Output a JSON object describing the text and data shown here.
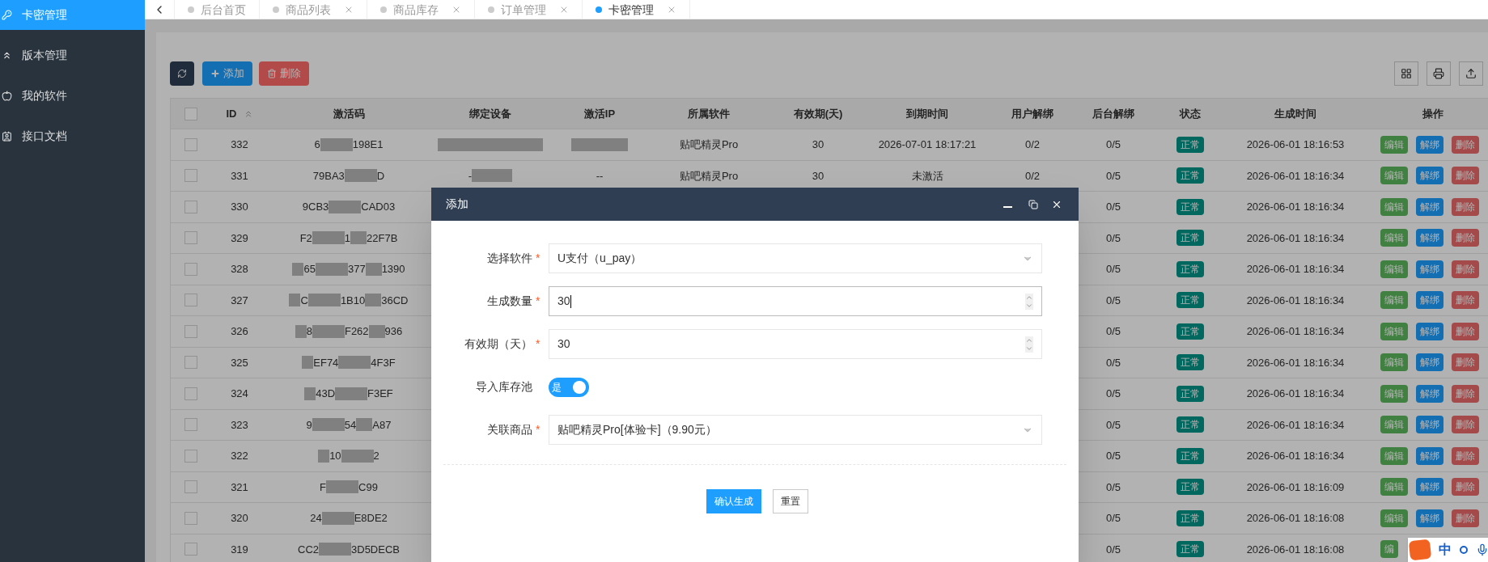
{
  "sidebar": {
    "items": [
      {
        "label": "卡密管理",
        "selected": true
      },
      {
        "label": "版本管理",
        "selected": false
      },
      {
        "label": "我的软件",
        "selected": false
      },
      {
        "label": "接口文档",
        "selected": false
      }
    ]
  },
  "tabs": [
    {
      "label": "后台首页",
      "closable": false,
      "selected": false
    },
    {
      "label": "商品列表",
      "closable": true,
      "selected": false
    },
    {
      "label": "商品库存",
      "closable": true,
      "selected": false
    },
    {
      "label": "订单管理",
      "closable": true,
      "selected": false
    },
    {
      "label": "卡密管理",
      "closable": true,
      "selected": true
    }
  ],
  "toolbar": {
    "add": "添加",
    "delete": "删除"
  },
  "table": {
    "columns": [
      "ID",
      "激活码",
      "绑定设备",
      "激活IP",
      "所属软件",
      "有效期(天)",
      "到期时间",
      "用户解绑",
      "后台解绑",
      "状态",
      "生成时间",
      "操作"
    ],
    "select_all": {
      "checked": false
    },
    "rows": [
      {
        "checked": false,
        "id": "332",
        "lead_blur": false,
        "code": [
          "6",
          "198E1"
        ],
        "device_blur": true,
        "ip_blur": true,
        "software": "贴吧精灵Pro",
        "period": "30",
        "expire": "2026-07-01 18:17:21",
        "user_unbind": "0/2",
        "admin_unbind": "0/5",
        "status": "正常",
        "created": "2026-06-01 18:16:53",
        "actions": [
          "编辑",
          "解绑",
          "删除"
        ]
      },
      {
        "checked": false,
        "id": "331",
        "lead_blur": false,
        "code": [
          "79BA3",
          "D"
        ],
        "device": "-",
        "device_blur": true,
        "ip": "--",
        "ip_blur": false,
        "software": "贴吧精灵Pro",
        "period": "30",
        "expire": "未激活",
        "user_unbind": "0/2",
        "admin_unbind": "0/5",
        "status": "正常",
        "created": "2026-06-01 18:16:34",
        "actions": [
          "编辑",
          "解绑",
          "删除"
        ]
      },
      {
        "checked": false,
        "id": "330",
        "lead_blur": false,
        "code": [
          "9CB3",
          "CAD03"
        ],
        "admin_unbind": "0/5",
        "status": "正常",
        "created": "2026-06-01 18:16:34",
        "actions": [
          "编辑",
          "解绑",
          "删除"
        ]
      },
      {
        "checked": false,
        "id": "329",
        "lead_blur": false,
        "code": [
          "F2",
          "1",
          "22F7B"
        ],
        "admin_unbind": "0/5",
        "status": "正常",
        "created": "2026-06-01 18:16:34",
        "actions": [
          "编辑",
          "解绑",
          "删除"
        ]
      },
      {
        "checked": false,
        "id": "328",
        "lead_blur": true,
        "code": [
          "65",
          "377",
          "1390"
        ],
        "admin_unbind": "0/5",
        "status": "正常",
        "created": "2026-06-01 18:16:34",
        "actions": [
          "编辑",
          "解绑",
          "删除"
        ]
      },
      {
        "checked": false,
        "id": "327",
        "lead_blur": true,
        "code": [
          "C",
          "1B10",
          "36CD"
        ],
        "admin_unbind": "0/5",
        "status": "正常",
        "created": "2026-06-01 18:16:34",
        "actions": [
          "编辑",
          "解绑",
          "删除"
        ]
      },
      {
        "checked": false,
        "id": "326",
        "lead_blur": true,
        "code": [
          "8",
          "F262",
          "936"
        ],
        "admin_unbind": "0/5",
        "status": "正常",
        "created": "2026-06-01 18:16:34",
        "actions": [
          "编辑",
          "解绑",
          "删除"
        ]
      },
      {
        "checked": false,
        "id": "325",
        "lead_blur": true,
        "code": [
          "EF74",
          "4F3F"
        ],
        "admin_unbind": "0/5",
        "status": "正常",
        "created": "2026-06-01 18:16:34",
        "actions": [
          "编辑",
          "解绑",
          "删除"
        ]
      },
      {
        "checked": false,
        "id": "324",
        "lead_blur": true,
        "code": [
          "43D",
          "F3EF"
        ],
        "admin_unbind": "0/5",
        "status": "正常",
        "created": "2026-06-01 18:16:34",
        "actions": [
          "编辑",
          "解绑",
          "删除"
        ]
      },
      {
        "checked": false,
        "id": "323",
        "lead_blur": false,
        "code": [
          "9",
          "54",
          "A87"
        ],
        "admin_unbind": "0/5",
        "status": "正常",
        "created": "2026-06-01 18:16:34",
        "actions": [
          "编辑",
          "解绑",
          "删除"
        ]
      },
      {
        "checked": false,
        "id": "322",
        "lead_blur": true,
        "code": [
          "10",
          "2"
        ],
        "admin_unbind": "0/5",
        "status": "正常",
        "created": "2026-06-01 18:16:34",
        "actions": [
          "编辑",
          "解绑",
          "删除"
        ]
      },
      {
        "checked": false,
        "id": "321",
        "lead_blur": false,
        "code": [
          "F",
          "C99"
        ],
        "admin_unbind": "0/5",
        "status": "正常",
        "created": "2026-06-01 18:16:09",
        "actions": [
          "编辑",
          "解绑",
          "删除"
        ]
      },
      {
        "checked": false,
        "id": "320",
        "lead_blur": false,
        "code": [
          "24",
          "E8DE2"
        ],
        "admin_unbind": "0/5",
        "status": "正常",
        "created": "2026-06-01 18:16:08",
        "actions": [
          "编辑",
          "解绑",
          "删除"
        ]
      },
      {
        "checked": false,
        "id": "319",
        "lead_blur": false,
        "code": [
          "CC2",
          "3D5DECB"
        ],
        "admin_unbind": "0/5",
        "status": "正常",
        "created": "2026-06-01 18:16:08",
        "actions": [
          "编"
        ]
      }
    ]
  },
  "dialog": {
    "title": "添加",
    "fields": [
      {
        "kind": "select",
        "label": "选择软件",
        "required_mark": "*",
        "value": "U支付（u_pay）"
      },
      {
        "kind": "number",
        "label": "生成数量",
        "required_mark": "*",
        "value": "30",
        "focused": true
      },
      {
        "kind": "number",
        "label": "有效期（天）",
        "required_mark": "*",
        "value": "30",
        "focused": false
      },
      {
        "kind": "switch",
        "label": "导入库存池",
        "on": true,
        "value": "是"
      },
      {
        "kind": "select",
        "label": "关联商品",
        "required_mark": "*",
        "value": "贴吧精灵Pro[体验卡]（9.90元）"
      }
    ],
    "buttons": [
      {
        "label": "确认生成",
        "primary": true
      },
      {
        "label": "重置",
        "primary": false
      }
    ]
  },
  "ime": {
    "mode": "中"
  }
}
